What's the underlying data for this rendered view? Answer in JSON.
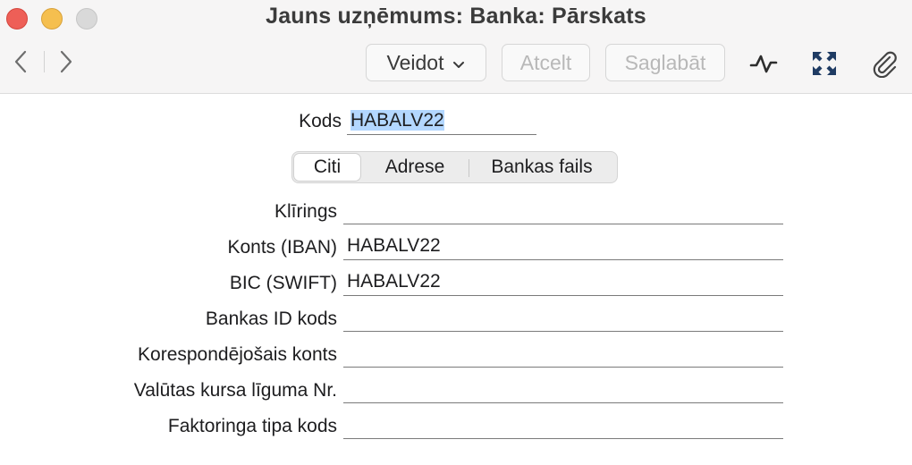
{
  "window": {
    "title": "Jauns uzņēmums: Banka: Pārskats"
  },
  "toolbar": {
    "create_label": "Veidot",
    "cancel_label": "Atcelt",
    "save_label": "Saglabāt",
    "icons": [
      "back-icon",
      "forward-icon",
      "chevron-down-icon",
      "activity-icon",
      "expand-icon",
      "paperclip-icon"
    ]
  },
  "header": {
    "code_label": "Kods",
    "code_value": "HABALV22"
  },
  "tabs": [
    {
      "label": "Citi",
      "selected": true
    },
    {
      "label": "Adrese",
      "selected": false
    },
    {
      "label": "Bankas fails",
      "selected": false
    }
  ],
  "form": {
    "fields": [
      {
        "label": "Klīrings",
        "value": ""
      },
      {
        "label": "Konts (IBAN)",
        "value": "HABALV22"
      },
      {
        "label": "BIC (SWIFT)",
        "value": "HABALV22"
      },
      {
        "label": "Bankas ID kods",
        "value": ""
      },
      {
        "label": "Korespondējošais konts",
        "value": ""
      },
      {
        "label": "Valūtas kursa līguma Nr.",
        "value": ""
      },
      {
        "label": "Faktoringa tipa kods",
        "value": ""
      }
    ]
  },
  "colors": {
    "selection": "#b3d7ff",
    "close": "#ee5f57",
    "minimize": "#f5bf4f",
    "zoom_inactive": "#d9d9d9"
  }
}
